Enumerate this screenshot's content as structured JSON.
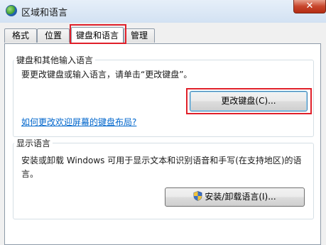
{
  "window": {
    "title": "区域和语言",
    "close_glyph": "✕"
  },
  "tabs": [
    {
      "label": "格式",
      "active": false
    },
    {
      "label": "位置",
      "active": false
    },
    {
      "label": "键盘和语言",
      "active": true
    },
    {
      "label": "管理",
      "active": false
    }
  ],
  "keyboards_group": {
    "label": "键盘和其他输入语言",
    "instruction": "要更改键盘或输入语言，请单击“更改键盘”。",
    "change_button": "更改键盘(C)...",
    "help_link": "如何更改欢迎屏幕的键盘布局?"
  },
  "display_group": {
    "label": "显示语言",
    "description_line1": "安装或卸载 Windows 可用于显示文本和识别语音和手写(在支持地区)的语",
    "description_line2": "言。",
    "install_button": "安装/卸载语言(I)...",
    "install_button_icon": "uac-shield-icon"
  },
  "colors": {
    "highlight": "#e0202a",
    "link": "#0066cc"
  }
}
